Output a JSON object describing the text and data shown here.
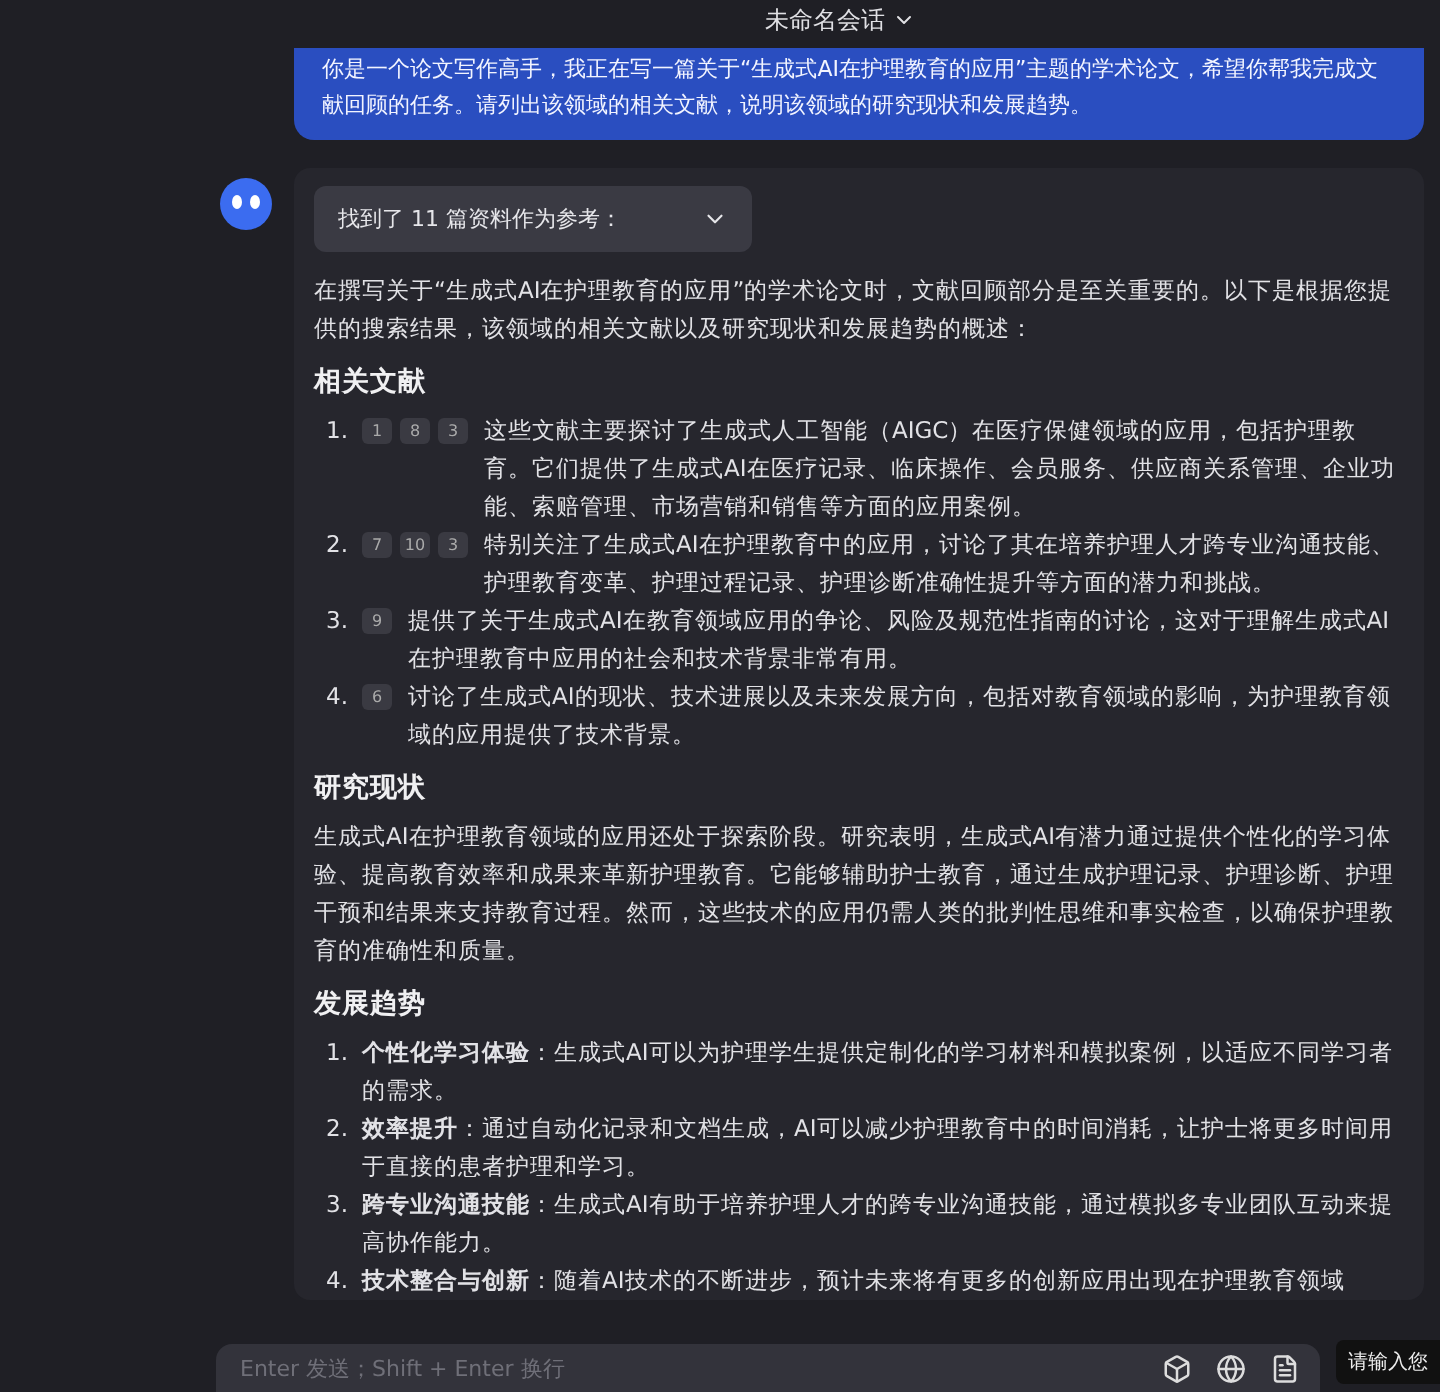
{
  "header": {
    "title": "未命名会话"
  },
  "user_message": {
    "text": "你是一个论文写作高手，我正在写一篇关于“生成式AI在护理教育的应用”主题的学术论文，希望你帮我完成文献回顾的任务。请列出该领域的相关文献，说明该领域的研究现状和发展趋势。"
  },
  "answer": {
    "sources_button": {
      "label": "找到了 11 篇资料作为参考：",
      "expanded": false
    },
    "intro": "在撰写关于“生成式AI在护理教育的应用”的学术论文时，文献回顾部分是至关重要的。以下是根据您提供的搜索结果，该领域的相关文献以及研究现状和发展趋势的概述：",
    "sections": [
      {
        "kind": "list",
        "heading": "相关文献",
        "items": [
          {
            "marker": "1.",
            "citations": [
              "1",
              "8",
              "3"
            ],
            "text": "这些文献主要探讨了生成式人工智能（AIGC）在医疗保健领域的应用，包括护理教育。它们提供了生成式AI在医疗记录、临床操作、会员服务、供应商关系管理、企业功能、索赔管理、市场营销和销售等方面的应用案例。"
          },
          {
            "marker": "2.",
            "citations": [
              "7",
              "10",
              "3"
            ],
            "text": "特别关注了生成式AI在护理教育中的应用，讨论了其在培养护理人才跨专业沟通技能、护理教育变革、护理过程记录、护理诊断准确性提升等方面的潜力和挑战。"
          },
          {
            "marker": "3.",
            "citations": [
              "9"
            ],
            "text": "提供了关于生成式AI在教育领域应用的争论、风险及规范性指南的讨论，这对于理解生成式AI在护理教育中应用的社会和技术背景非常有用。"
          },
          {
            "marker": "4.",
            "citations": [
              "6"
            ],
            "text": "讨论了生成式AI的现状、技术进展以及未来发展方向，包括对教育领域的影响，为护理教育领域的应用提供了技术背景。"
          }
        ]
      },
      {
        "kind": "paragraph",
        "heading": "研究现状",
        "text": "生成式AI在护理教育领域的应用还处于探索阶段。研究表明，生成式AI有潜力通过提供个性化的学习体验、提高教育效率和成果来革新护理教育。它能够辅助护士教育，通过生成护理记录、护理诊断、护理干预和结果来支持教育过程。然而，这些技术的应用仍需人类的批判性思维和事实检查，以确保护理教育的准确性和质量。"
      },
      {
        "kind": "list",
        "heading": "发展趋势",
        "items": [
          {
            "marker": "1.",
            "text": "**个性化学习体验**：生成式AI可以为护理学生提供定制化的学习材料和模拟案例，以适应不同学习者的需求。"
          },
          {
            "marker": "2.",
            "text": "**效率提升**：通过自动化记录和文档生成，AI可以减少护理教育中的时间消耗，让护士将更多时间用于直接的患者护理和学习。"
          },
          {
            "marker": "3.",
            "text": "**跨专业沟通技能**：生成式AI有助于培养护理人才的跨专业沟通技能，通过模拟多专业团队互动来提高协作能力。"
          },
          {
            "marker": "4.",
            "text": "**技术整合与创新**：随着AI技术的不断进步，预计未来将有更多的创新应用出现在护理教育领域"
          }
        ]
      }
    ]
  },
  "input": {
    "placeholder": "Enter 发送；Shift + Enter 换行"
  },
  "tooltip": {
    "text": "请输入您"
  }
}
